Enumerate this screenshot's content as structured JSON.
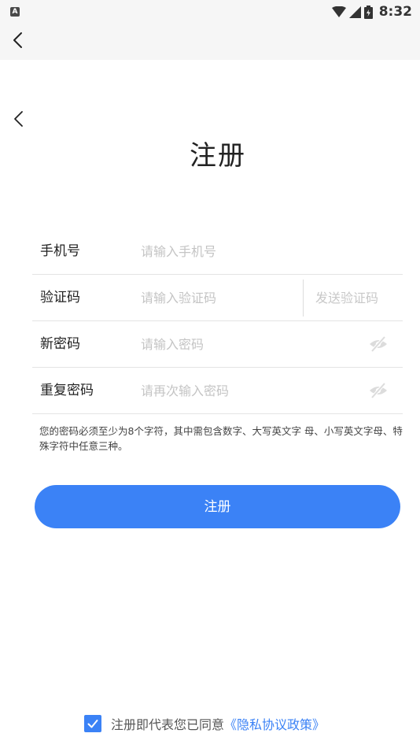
{
  "status_bar": {
    "app_icon_letter": "A",
    "time": "8:32",
    "icons": [
      "wifi-icon",
      "signal-icon",
      "battery-icon"
    ]
  },
  "page": {
    "title": "注册"
  },
  "form": {
    "phone": {
      "label": "手机号",
      "placeholder": "请输入手机号",
      "value": ""
    },
    "code": {
      "label": "验证码",
      "placeholder": "请输入验证码",
      "value": "",
      "send_label": "发送验证码"
    },
    "new_password": {
      "label": "新密码",
      "placeholder": "请输入密码",
      "value": ""
    },
    "repeat_password": {
      "label": "重复密码",
      "placeholder": "请再次输入密码",
      "value": ""
    }
  },
  "hint": "您的密码必须至少为8个字符，其中需包含数字、大写英文字 母、小写英文字母、特殊字符中任意三种。",
  "submit_label": "注册",
  "agreement": {
    "checked": true,
    "text": "注册即代表您已同意",
    "policy_link": "《隐私协议政策》"
  },
  "colors": {
    "accent": "#3b82f6",
    "status_bar_bg": "#f6f6f6"
  }
}
